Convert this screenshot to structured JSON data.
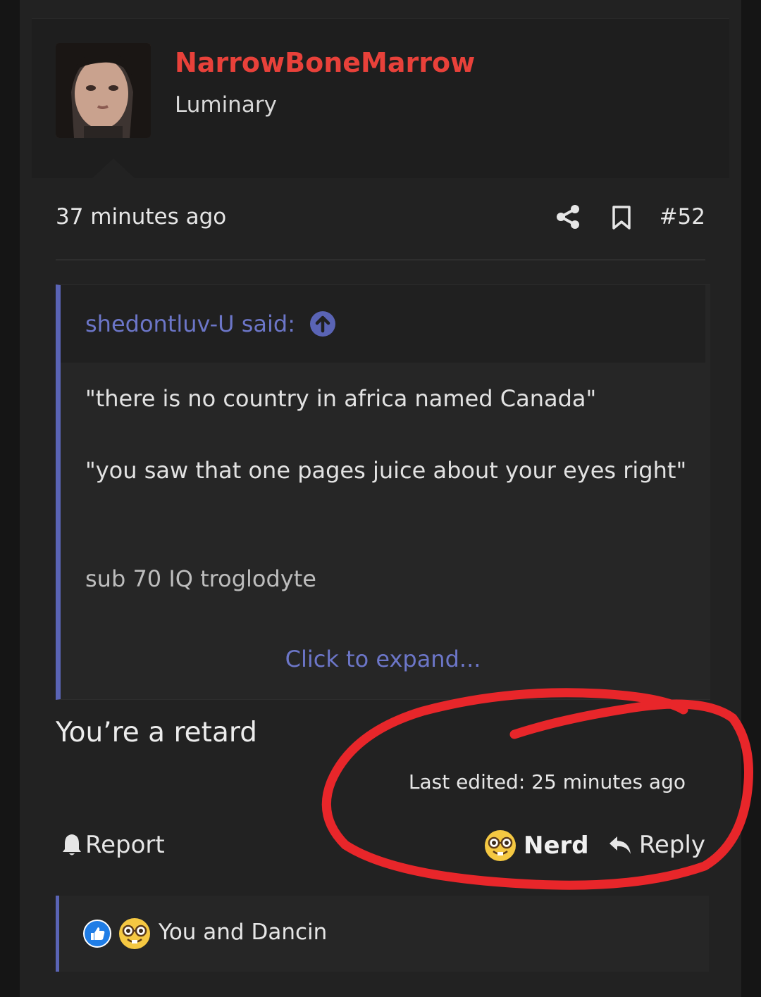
{
  "post": {
    "username": "NarrowBoneMarrow",
    "user_title": "Luminary",
    "time": "37 minutes ago",
    "number": "#52",
    "body": "You’re a retard",
    "last_edited": "Last edited: 25 minutes ago"
  },
  "quote": {
    "author": "shedontluv-U said:",
    "lines": [
      "\"there is no country in africa named Canada\"",
      "\"you saw that one pages juice about your eyes right\"",
      "sub 70 IQ troglodyte"
    ],
    "expand": "Click to expand..."
  },
  "actions": {
    "report": "Report",
    "nerd": "Nerd",
    "reply": "Reply"
  },
  "reactions": {
    "text": "You and Dancin"
  },
  "colors": {
    "username": "#e8413a",
    "accent": "#5a64b5",
    "link": "#6c76c8",
    "annotation": "#e8262a"
  },
  "icons": [
    "share-icon",
    "bookmark-icon",
    "quote-jump-icon",
    "bell-icon",
    "nerd-emoji-icon",
    "reply-arrow-icon",
    "like-icon"
  ]
}
